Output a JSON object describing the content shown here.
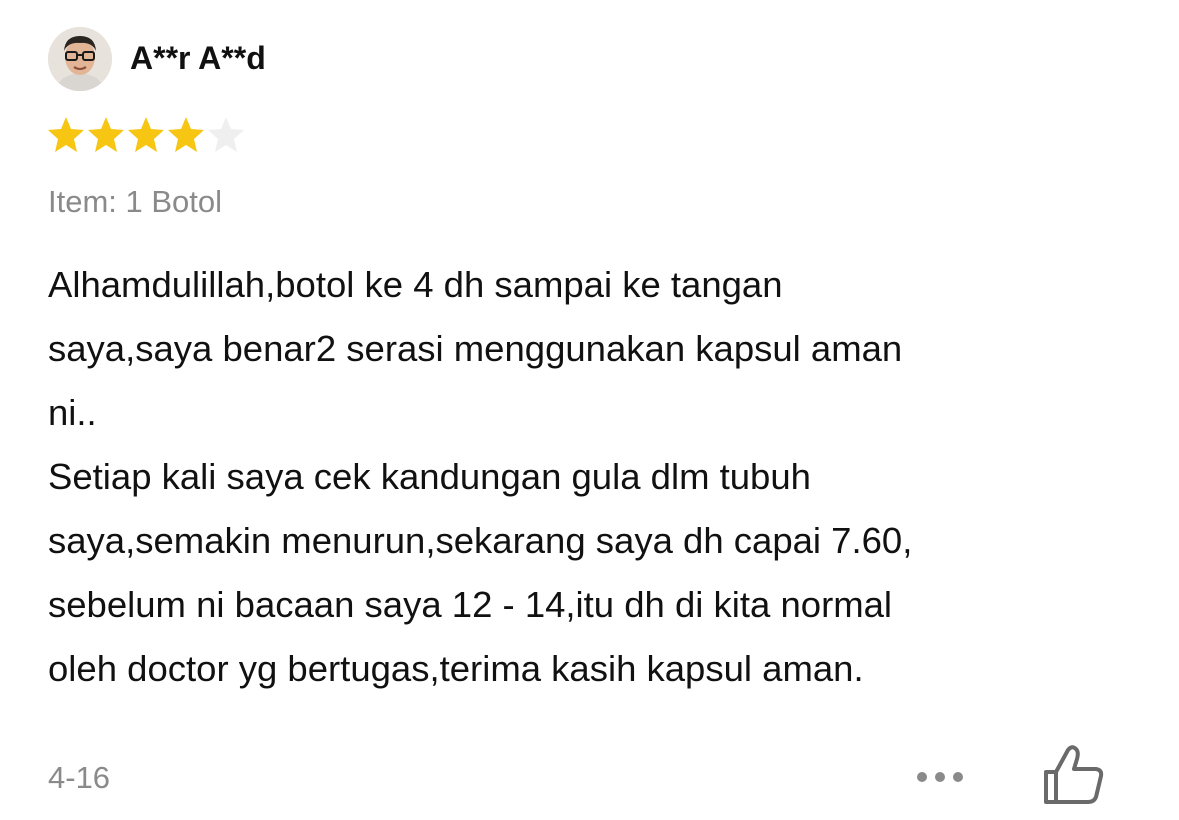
{
  "review": {
    "username": "A**r A**d",
    "rating": 4,
    "max_rating": 5,
    "star_color": "#F7C613",
    "star_empty_color": "#EFEFEF",
    "item_label": "Item: 1 Botol",
    "text_lines": [
      "Alhamdulillah,botol ke 4 dh sampai ke tangan",
      "saya,saya benar2 serasi menggunakan kapsul aman",
      "ni..",
      "Setiap kali saya cek kandungan gula dlm tubuh",
      "saya,semakin menurun,sekarang saya dh capai 7.60,",
      "sebelum ni bacaan saya 12 - 14,itu dh di kita normal",
      "oleh doctor yg bertugas,terima kasih kapsul aman."
    ],
    "date": "4-16",
    "more_icon": "more-dots-icon",
    "like_icon": "thumbs-up-icon"
  }
}
